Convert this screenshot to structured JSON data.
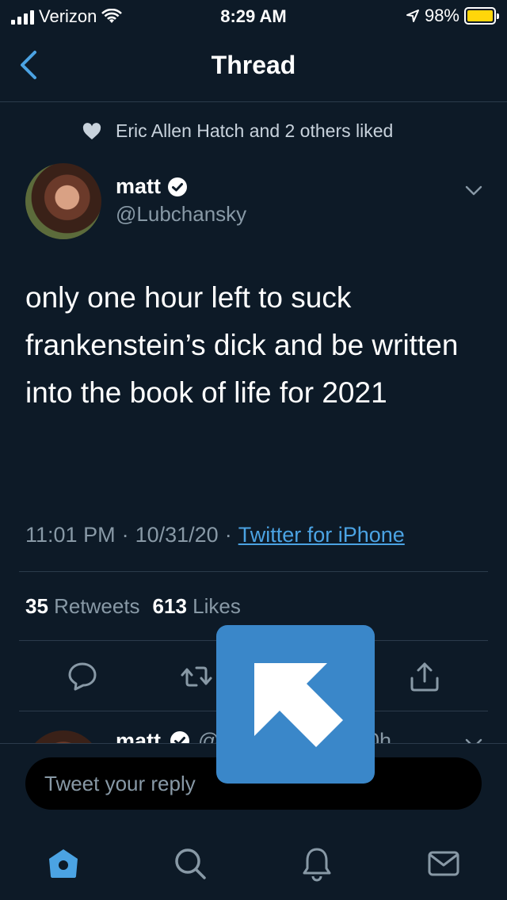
{
  "status_bar": {
    "carrier": "Verizon",
    "time": "8:29 AM",
    "battery": "98%",
    "battery_level": 0.98
  },
  "nav": {
    "title": "Thread",
    "back_icon": "chevron-left-icon"
  },
  "social_context": {
    "icon": "heart-icon",
    "text": "Eric Allen Hatch and 2 others liked"
  },
  "tweet": {
    "author_name": "matt",
    "verified_icon": "verified-badge-icon",
    "handle": "@Lubchansky",
    "text": "only one hour left to suck frankenstein’s dick and be written into the book of life for 2021",
    "time": "11:01 PM",
    "date": "10/31/20",
    "source": "Twitter for iPhone",
    "retweets_count": "35",
    "retweets_label": "Retweets",
    "likes_count": "613",
    "likes_label": "Likes"
  },
  "actions": [
    "reply-icon",
    "retweet-icon",
    "like-icon",
    "share-icon"
  ],
  "next_reply": {
    "author_name": "matt",
    "handle_partial": "@",
    "time_partial": "0h"
  },
  "compose": {
    "placeholder": "Tweet your reply"
  },
  "overlay": {
    "icon": "arrow-up-left-icon",
    "color": "#3a87c9"
  },
  "tab_bar": [
    "home-icon",
    "search-icon",
    "notifications-icon",
    "messages-icon"
  ],
  "colors": {
    "background": "#0d1a27",
    "accent": "#4ba3e3",
    "muted": "#8899a6"
  }
}
